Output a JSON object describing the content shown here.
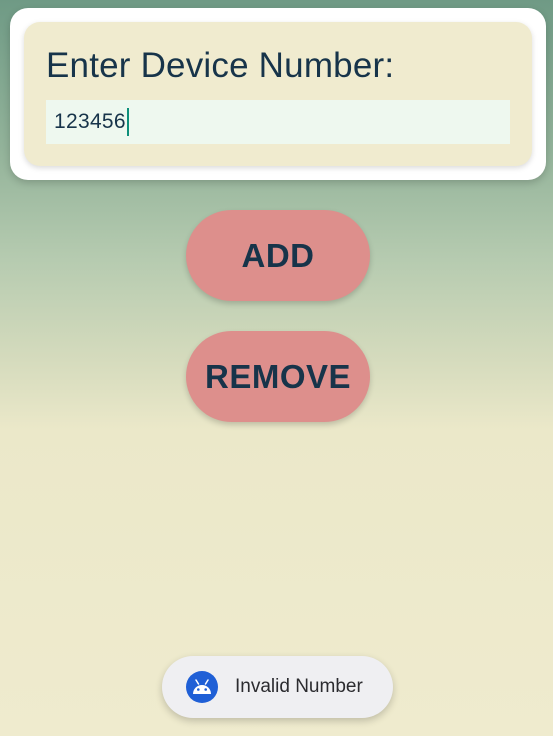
{
  "card": {
    "title": "Enter Device Number:",
    "input_value": "123456"
  },
  "buttons": {
    "add_label": "ADD",
    "remove_label": "REMOVE"
  },
  "toast": {
    "icon": "android-icon",
    "message": "Invalid Number"
  },
  "colors": {
    "button": "#dd8f8c",
    "text": "#17344a",
    "card": "#f0ebcf",
    "input": "#eef8ef",
    "caret": "#0e8f7a",
    "toast_icon": "#1f5fd6"
  }
}
